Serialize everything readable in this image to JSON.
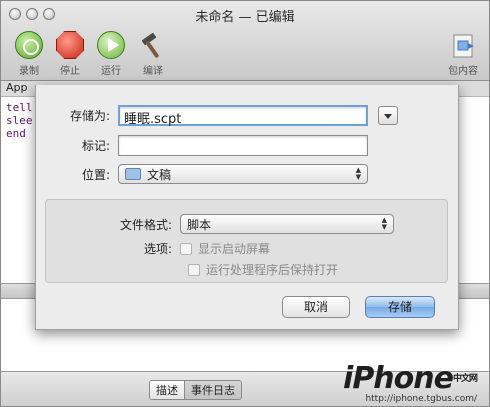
{
  "window": {
    "title": "未命名 — 已编辑"
  },
  "toolbar": {
    "record": "录制",
    "stop": "停止",
    "run": "运行",
    "compile": "编译",
    "bundle": "包内容"
  },
  "navbar": {
    "partial_label": "App"
  },
  "editor": {
    "lines": [
      "tell",
      "slee",
      "end"
    ]
  },
  "footer": {
    "tabs": [
      "描述",
      "事件日志"
    ]
  },
  "watermark": {
    "brand": "iPhone",
    "brand_suffix": "中文网",
    "url": "http://iphone.tgbus.com/"
  },
  "save_sheet": {
    "save_as_label": "存储为:",
    "save_as_value": "睡眠.scpt",
    "tags_label": "标记:",
    "tags_value": "",
    "location_label": "位置:",
    "location_value": "文稿",
    "format_label": "文件格式:",
    "format_value": "脚本",
    "options_label": "选项:",
    "option_startup": "显示启动屏幕",
    "option_stay_open": "运行处理程序后保持打开",
    "cancel": "取消",
    "save": "存储"
  }
}
